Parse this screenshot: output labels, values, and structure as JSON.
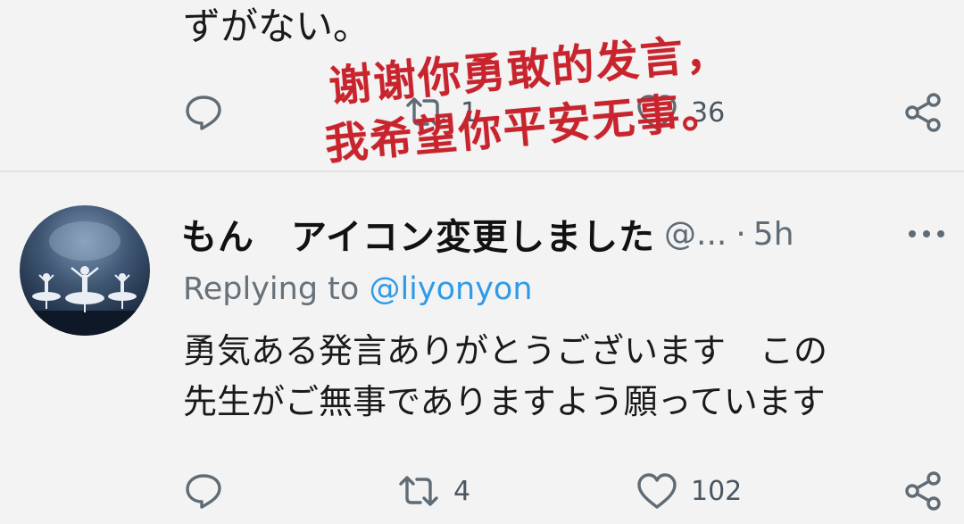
{
  "previous_tweet": {
    "text_tail": "ずがない。",
    "actions": {
      "retweet_count": "1",
      "like_count": "36"
    }
  },
  "reply_tweet": {
    "display_name": "もん　アイコン変更しました",
    "handle": "@...",
    "separator": "·",
    "time": "5h",
    "replying_prefix": "Replying to ",
    "replying_handle": "@liyonyon",
    "text_lines": [
      "勇気ある発言ありがとうございます　この",
      "先生がご無事でありますよう願っています"
    ],
    "actions": {
      "retweet_count": "4",
      "like_count": "102"
    }
  },
  "overlay_caption": {
    "line1": "谢谢你勇敢的发言，",
    "line2": "我希望你平安无事。",
    "color": "#c8242d"
  },
  "icons": {
    "reply": "speech-bubble-icon",
    "retweet": "retweet-arrows-icon",
    "like": "heart-icon",
    "share": "share-nodes-icon",
    "more": "ellipsis-icon"
  },
  "colors": {
    "background": "#f3f3f3",
    "text": "#1a1a1a",
    "muted": "#5f6b75",
    "link": "#2f9be8"
  }
}
